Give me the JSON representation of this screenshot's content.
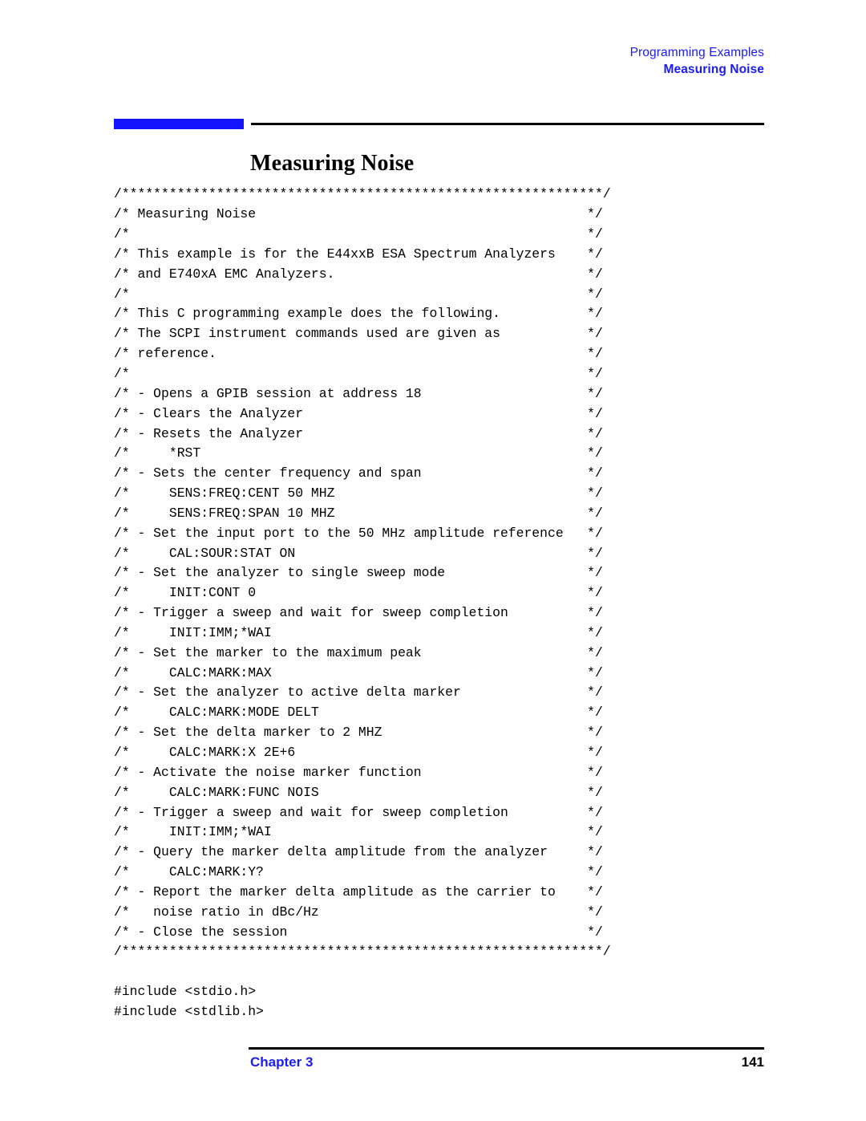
{
  "header": {
    "line1": "Programming Examples",
    "line2": "Measuring Noise",
    "accent_color": "#1a1aff"
  },
  "title_rule": {
    "blue_block_color": "#1414ff",
    "line_color": "#000000"
  },
  "title": "Measuring Noise",
  "code": {
    "lines": [
      "/*************************************************************/",
      "/* Measuring Noise                                          */",
      "/*                                                          */",
      "/* This example is for the E44xxB ESA Spectrum Analyzers    */",
      "/* and E740xA EMC Analyzers.                                */",
      "/*                                                          */",
      "/* This C programming example does the following.           */",
      "/* The SCPI instrument commands used are given as           */",
      "/* reference.                                               */",
      "/*                                                          */",
      "/* - Opens a GPIB session at address 18                     */",
      "/* - Clears the Analyzer                                    */",
      "/* - Resets the Analyzer                                    */",
      "/*     *RST                                                 */",
      "/* - Sets the center frequency and span                     */",
      "/*     SENS:FREQ:CENT 50 MHZ                                */",
      "/*     SENS:FREQ:SPAN 10 MHZ                                */",
      "/* - Set the input port to the 50 MHz amplitude reference   */",
      "/*     CAL:SOUR:STAT ON                                     */",
      "/* - Set the analyzer to single sweep mode                  */",
      "/*     INIT:CONT 0                                          */",
      "/* - Trigger a sweep and wait for sweep completion          */",
      "/*     INIT:IMM;*WAI                                        */",
      "/* - Set the marker to the maximum peak                     */",
      "/*     CALC:MARK:MAX                                        */",
      "/* - Set the analyzer to active delta marker                */",
      "/*     CALC:MARK:MODE DELT                                  */",
      "/* - Set the delta marker to 2 MHZ                          */",
      "/*     CALC:MARK:X 2E+6                                     */",
      "/* - Activate the noise marker function                     */",
      "/*     CALC:MARK:FUNC NOIS                                  */",
      "/* - Trigger a sweep and wait for sweep completion          */",
      "/*     INIT:IMM;*WAI                                        */",
      "/* - Query the marker delta amplitude from the analyzer     */",
      "/*     CALC:MARK:Y?                                         */",
      "/* - Report the marker delta amplitude as the carrier to    */",
      "/*   noise ratio in dBc/Hz                                  */",
      "/* - Close the session                                      */",
      "/*************************************************************/",
      "",
      "#include <stdio.h>",
      "#include <stdlib.h>"
    ]
  },
  "footer": {
    "chapter": "Chapter 3",
    "page_number": "141",
    "chapter_color": "#1a1aff"
  }
}
